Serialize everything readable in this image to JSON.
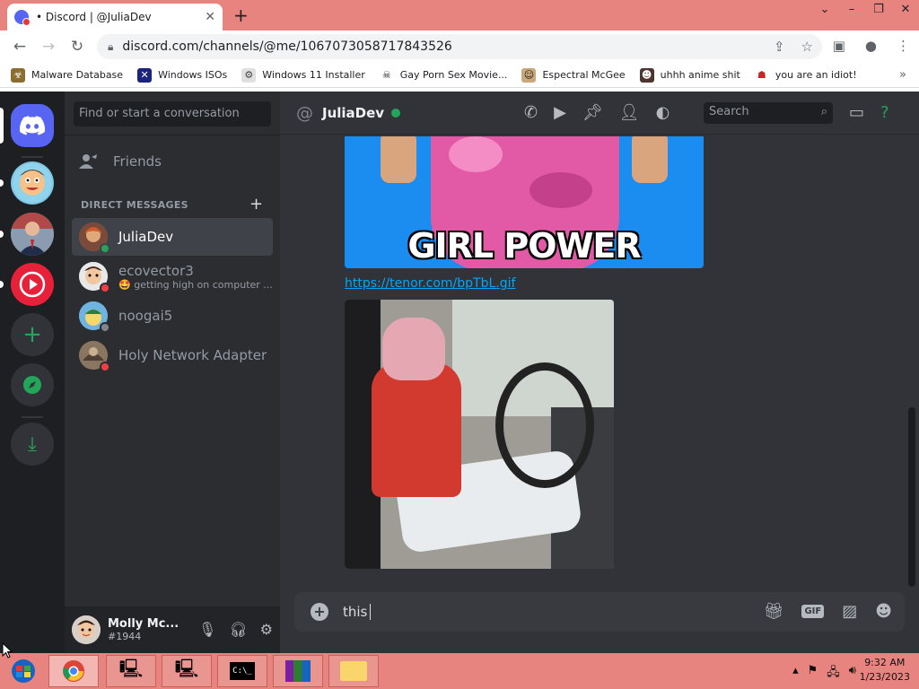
{
  "browser": {
    "tab_title": "• Discord | @JuliaDev",
    "url": "discord.com/channels/@me/1067073058717843526",
    "bookmarks": [
      "Malware Database",
      "Windows ISOs",
      "Windows 11 Installer",
      "Gay Porn Sex Movie...",
      "Espectral McGee",
      "uhhh anime shit",
      "you are an idiot!"
    ]
  },
  "discord": {
    "search_placeholder": "Find or start a conversation",
    "friends_label": "Friends",
    "dm_header": "DIRECT MESSAGES",
    "dms": [
      {
        "name": "JuliaDev",
        "subtitle": "",
        "status": "online"
      },
      {
        "name": "ecovector3",
        "subtitle": "🤩 getting high on computer ...",
        "status": "dnd"
      },
      {
        "name": "noogai5",
        "subtitle": "",
        "status": "offline"
      },
      {
        "name": "Holy Network Adapter",
        "subtitle": "",
        "status": "dnd"
      }
    ],
    "user": {
      "name": "Molly Mc...",
      "tag": "#1944"
    },
    "chat": {
      "recipient": "JuliaDev",
      "header_search": "Search",
      "gif_caption": "GIRL  POWER",
      "link": "https://tenor.com/bpTbL.gif",
      "composer_text": "this"
    },
    "colors": {
      "blurple": "#5865f2",
      "online": "#23a55a",
      "dnd": "#f23f43",
      "link": "#00a8fc"
    }
  },
  "taskbar": {
    "time": "9:32 AM",
    "date": "1/23/2023"
  }
}
